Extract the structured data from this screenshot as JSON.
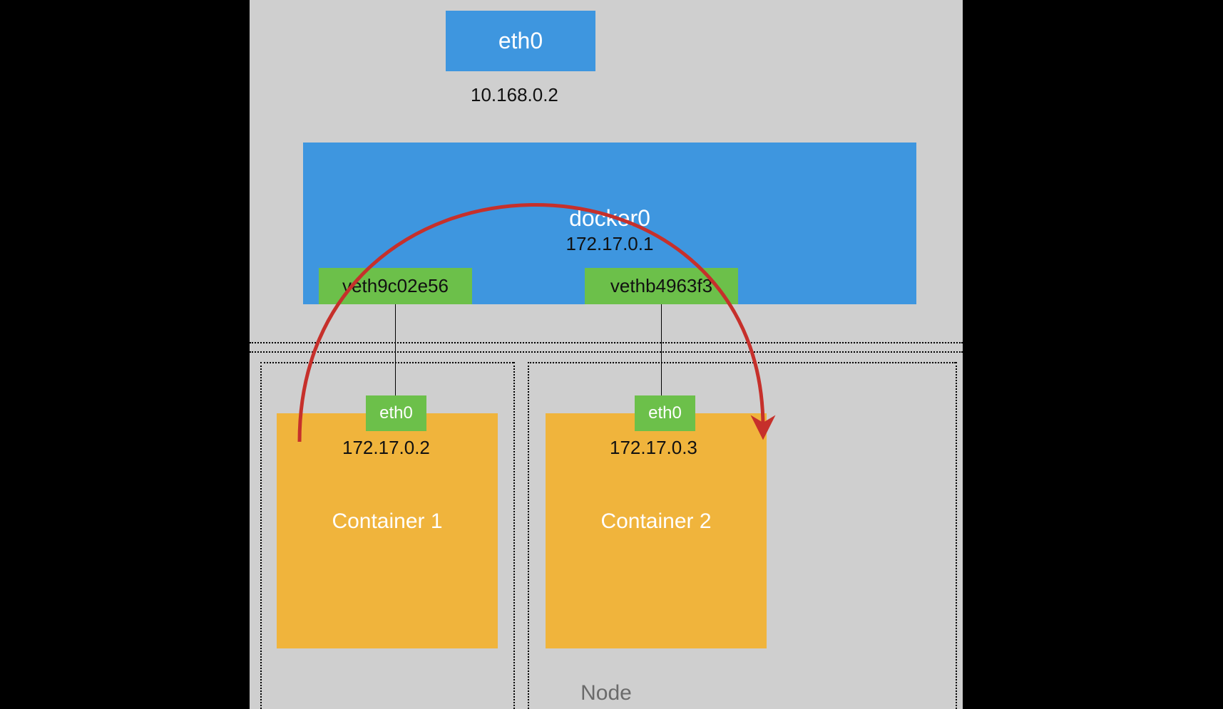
{
  "node": {
    "label": "Node",
    "host_interface": {
      "name": "eth0",
      "ip": "10.168.0.2"
    },
    "bridge": {
      "name": "docker0",
      "ip": "172.17.0.1",
      "veths": [
        {
          "name": "veth9c02e56"
        },
        {
          "name": "vethb4963f3"
        }
      ]
    },
    "containers": [
      {
        "label": "Container 1",
        "if_name": "eth0",
        "ip": "172.17.0.2"
      },
      {
        "label": "Container  2",
        "if_name": "eth0",
        "ip": "172.17.0.3"
      }
    ]
  }
}
